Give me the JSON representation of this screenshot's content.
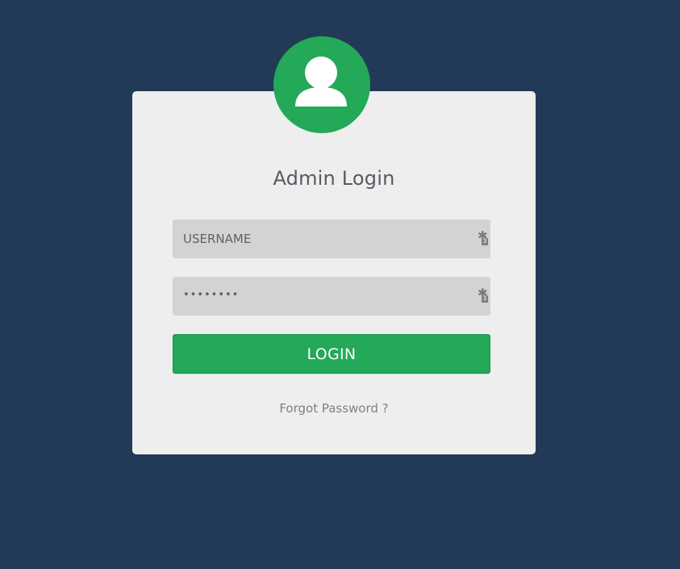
{
  "login_card": {
    "title": "Admin Login",
    "username": {
      "placeholder": "USERNAME",
      "value": ""
    },
    "password": {
      "placeholder": "",
      "value": "••••••••"
    },
    "password_manager_badge": {
      "icon": "asterisk-key-icon",
      "count": "3"
    },
    "login_button_label": "LOGIN",
    "forgot_password_label": "Forgot Password ?"
  },
  "colors": {
    "background": "#223a57",
    "card": "#eeeeef",
    "accent": "#23a958",
    "field": "#d3d3d4"
  },
  "icons": {
    "avatar": "user-icon"
  }
}
